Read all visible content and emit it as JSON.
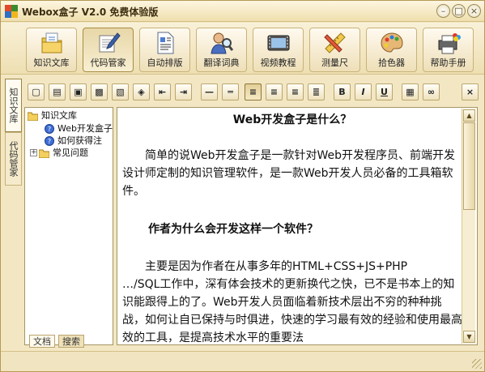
{
  "window": {
    "title": "Webox盒子 V2.0 免费体验版",
    "controls": {
      "minimize": "–",
      "maximize": "□",
      "close": "×"
    }
  },
  "toolbar": [
    {
      "label": "知识文库",
      "icon": "folder-pages-icon"
    },
    {
      "label": "代码管家",
      "icon": "pen-paper-icon",
      "active": true
    },
    {
      "label": "自动排版",
      "icon": "document-icon"
    },
    {
      "label": "翻译词典",
      "icon": "person-magnifier-icon"
    },
    {
      "label": "视频教程",
      "icon": "film-icon"
    },
    {
      "label": "测量尺",
      "icon": "ruler-pencil-icon"
    },
    {
      "label": "拾色器",
      "icon": "palette-icon"
    },
    {
      "label": "帮助手册",
      "icon": "printer-help-icon"
    }
  ],
  "side_tabs": [
    "知识文库",
    "代码管家"
  ],
  "format_toolbar": [
    {
      "name": "new-file-icon",
      "glyph": "▢"
    },
    {
      "name": "open-folder-icon",
      "glyph": "▤"
    },
    {
      "name": "save-disk-icon",
      "glyph": "▣"
    },
    {
      "name": "save-as-icon",
      "glyph": "▩"
    },
    {
      "name": "image-icon",
      "glyph": "▧"
    },
    {
      "name": "link-icon",
      "glyph": "◈"
    },
    {
      "name": "outdent-icon",
      "glyph": "⇤"
    },
    {
      "name": "indent-icon",
      "glyph": "⇥"
    },
    {
      "name": "hr-single-icon",
      "glyph": "—"
    },
    {
      "name": "hr-double-icon",
      "glyph": "═"
    },
    {
      "name": "align-left-icon",
      "glyph": "≡",
      "active": true
    },
    {
      "name": "align-center-icon",
      "glyph": "≡"
    },
    {
      "name": "align-right-icon",
      "glyph": "≡"
    },
    {
      "name": "align-justify-icon",
      "glyph": "≣"
    },
    {
      "name": "bold-icon",
      "glyph": "B"
    },
    {
      "name": "italic-icon",
      "glyph": "I"
    },
    {
      "name": "underline-icon",
      "glyph": "U"
    },
    {
      "name": "insert-image-icon",
      "glyph": "▦"
    },
    {
      "name": "find-binoculars-icon",
      "glyph": "∞"
    },
    {
      "name": "close-doc-icon",
      "glyph": "×"
    }
  ],
  "tree": [
    {
      "label": "知识文库",
      "level": 0,
      "icon": "folder-icon"
    },
    {
      "label": "Web开发盒子",
      "level": 1,
      "icon": "help-doc-icon"
    },
    {
      "label": "如何获得注",
      "level": 1,
      "icon": "help-doc-icon"
    },
    {
      "label": "常见问题",
      "level": 0,
      "icon": "folder-icon",
      "expander": "+"
    }
  ],
  "bottom_tabs": [
    "文档",
    "搜索"
  ],
  "document": {
    "title": "Web开发盒子是什么？",
    "para1": "简单的说Web开发盒子是一款针对Web开发程序员、前端开发设计师定制的知识管理软件，是一款Web开发人员必备的工具箱软件。",
    "subtitle": "作者为什么会开发这样一个软件？",
    "para2a": "主要是因为作者在从事多年的HTML+CSS+JS+PHP",
    "para2b": "…/SQL工作中，深有体会技术的更新换代之快，已不是书本上的知识能跟得上的了。Web开发人员面临着新技术层出不穷的种种挑战，如何让自已保持与时俱进，快速的学习最有效的经验和使用最高效的工具，是提高技术水平的重要法"
  },
  "colors": {
    "accent": "#e8d39c",
    "border": "#a69462",
    "chrome": "#f3e7c3"
  }
}
